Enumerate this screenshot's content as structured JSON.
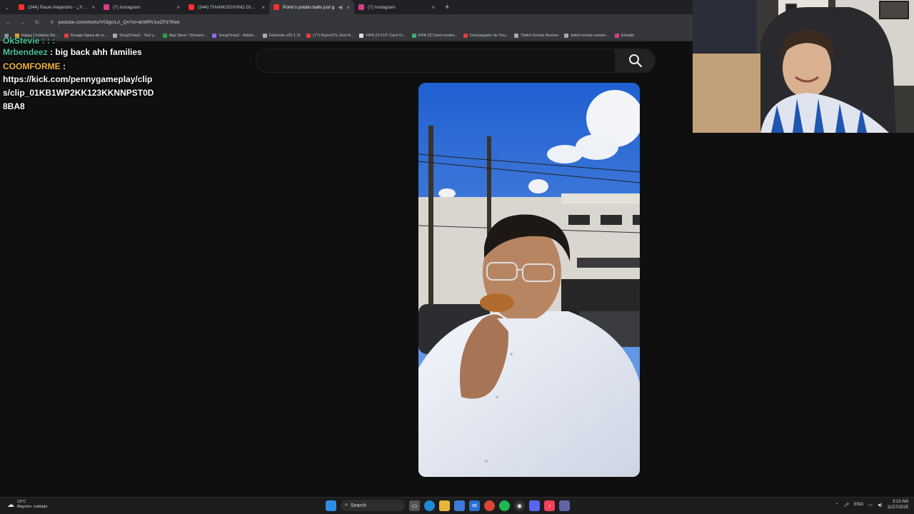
{
  "browser": {
    "tabs": [
      {
        "title": "(344) Rauw Alejandro - ¿Y Eso?",
        "color": "#ff2d2d"
      },
      {
        "title": "(7) Instagram",
        "color": "#d83f87"
      },
      {
        "title": "(344) THANKSGIVING DINNER",
        "color": "#ff2d2d"
      },
      {
        "title": "Porto's potato balls just g",
        "color": "#ff2d2d",
        "active": true
      },
      {
        "title": "(7) Instagram",
        "color": "#d83f87"
      }
    ],
    "url": "youtube.com/shorts/Y03gcrLA_QA?si=dcWRV1wZP37t0ek",
    "bookmarks": [
      {
        "label": "Happy Cristiano Ro...",
        "color": "#e0a020"
      },
      {
        "label": "Burago figura de to...",
        "color": "#e04040"
      },
      {
        "label": "SongTrivia2 - Test y...",
        "color": "#aaaaaa"
      },
      {
        "label": "App Store / Streami...",
        "color": "#2ea043"
      },
      {
        "label": "SongTrivia2 - Adivin...",
        "color": "#8a6cf0"
      },
      {
        "label": "Feletools v25.1.11",
        "color": "#aaaaaa"
      },
      {
        "label": "(77) Razor97s Zest-A...",
        "color": "#e04040"
      },
      {
        "label": "FIFA 23 FUT Card Cr...",
        "color": "#dddddd"
      },
      {
        "label": "FIFA 23 Card creator...",
        "color": "#3ab070"
      },
      {
        "label": "Descargador de You...",
        "color": "#e04040"
      },
      {
        "label": "Twitch Emote Resizer",
        "color": "#aaaaaa"
      },
      {
        "label": "twitch emote resizer...",
        "color": "#aaaaaa"
      },
      {
        "label": "Estudio",
        "color": "#d83f87"
      }
    ]
  },
  "search": {
    "placeholder": "",
    "value": ""
  },
  "chat": {
    "partial_line": "OkStevie : : :",
    "messages": [
      {
        "user": "Mrbendeez",
        "text": "big back ahh families",
        "color": "#4ec39a"
      },
      {
        "user": "COOMFORME",
        "text": "https://kick.com/pennygameplay/clips/clip_01KB1WP2KK123KKNNPST0D8BA8",
        "color": "#f2b43a"
      }
    ]
  },
  "taskbar": {
    "weather_temp": "13°C",
    "weather_desc": "Mayorm. nublado",
    "search_label": "Search",
    "lang": "ENG",
    "time": "3:10 AM",
    "date": "11/27/2025"
  }
}
